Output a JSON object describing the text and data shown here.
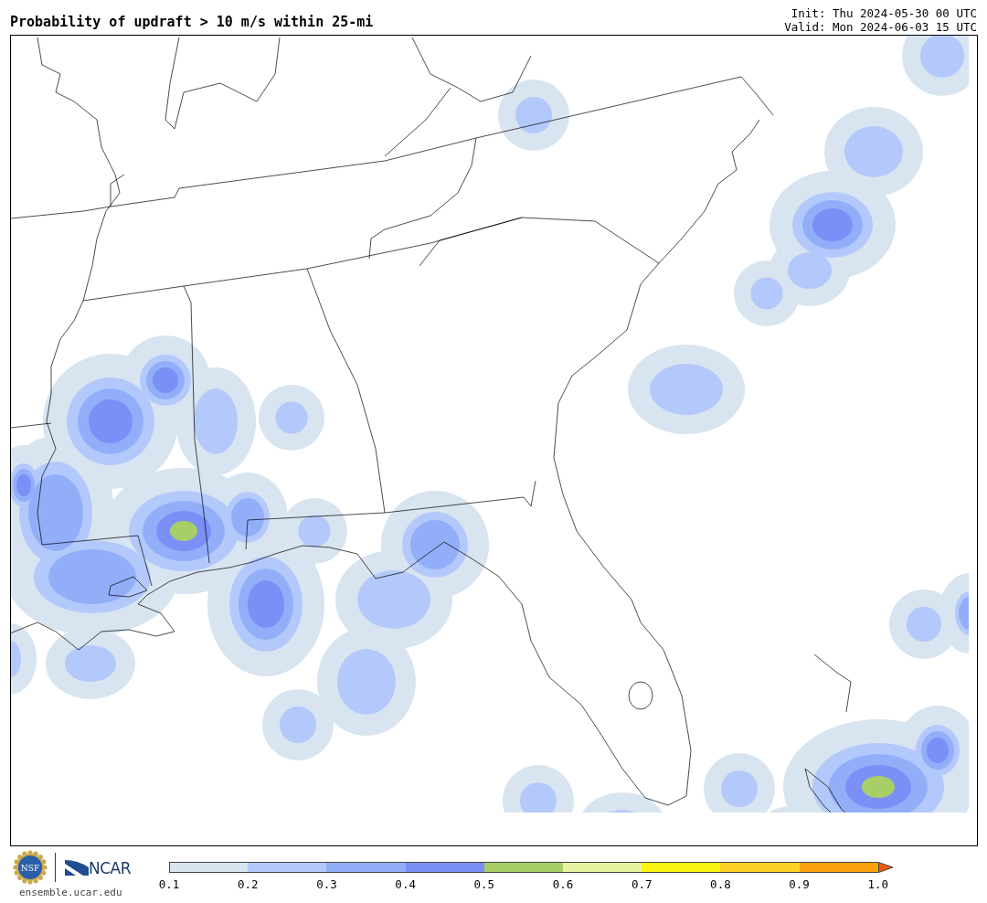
{
  "title": "Probability of updraft > 10 m/s within 25-mi",
  "init": "Init: Thu 2024-05-30 00 UTC",
  "valid": "Valid: Mon 2024-06-03 15 UTC",
  "footer": {
    "nsf_logo_text": "NSF",
    "ncar_logo_text": "NCAR",
    "website": "ensemble.ucar.edu"
  },
  "colorbar": {
    "segments": [
      {
        "kind": "bar",
        "color": "#d8e4f0"
      },
      {
        "kind": "bar",
        "color": "#b3c9fb"
      },
      {
        "kind": "bar",
        "color": "#93aef9"
      },
      {
        "kind": "bar",
        "color": "#7b8ff7"
      },
      {
        "kind": "bar",
        "color": "#a8cf67"
      },
      {
        "kind": "bar",
        "color": "#e6f4a0"
      },
      {
        "kind": "bar",
        "color": "#fbf514"
      },
      {
        "kind": "bar",
        "color": "#fdd126"
      },
      {
        "kind": "bar",
        "color": "#fba30e"
      },
      {
        "kind": "arrow",
        "color": "#f25a0c"
      }
    ],
    "ticks": [
      "0.1",
      "0.2",
      "0.3",
      "0.4",
      "0.5",
      "0.6",
      "0.7",
      "0.8",
      "0.9",
      "1.0"
    ]
  }
}
